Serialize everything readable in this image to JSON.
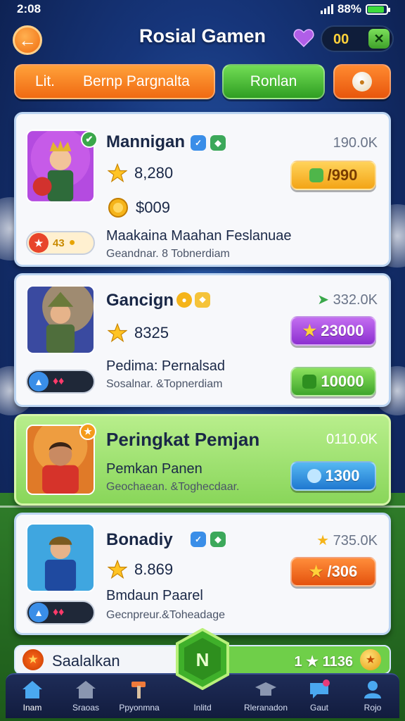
{
  "status": {
    "time": "2:08",
    "battery": "88%",
    "battery_level": 0.88
  },
  "header": {
    "title": "Rosial Gamen",
    "back_icon": "arrow-left-icon",
    "coins": "00",
    "add_label": "✕"
  },
  "tabs": [
    {
      "label_a": "Lit.",
      "label_b": "Bernp Pargnalta"
    },
    {
      "label": "Ronlan"
    },
    {
      "icon": "ball-icon"
    }
  ],
  "cards": [
    {
      "name": "Mannigan",
      "score": "190.0K",
      "stat1": "8,280",
      "stat2": "$009",
      "desc": "Maakaina Maahan Feslanuae",
      "sub": "Geandnar. 8 Tobnerdiam",
      "price": "/990",
      "rank": "43"
    },
    {
      "name": "Gancign",
      "score": "332.0K",
      "stat1": "8325",
      "desc": "Pedima: Pernalsad",
      "sub": "Sosalnar. &Topnerdiam",
      "price1": "23000",
      "price2": "10000"
    },
    {
      "name": "Peringkat Pemjan",
      "score": "0110.0K",
      "desc": "Pemkan Panen",
      "sub": "Geochaean. &Toghecdaar.",
      "price": "1300"
    },
    {
      "name": "Bonadiy",
      "score": "735.0K",
      "stat1": "8.869",
      "desc": "Bmdaun Paarel",
      "sub": "Gecnpreur.&Toheadage",
      "price": "/306"
    }
  ],
  "banner": {
    "label": "Saalalkan",
    "value": "1 ★ 1136"
  },
  "nav": [
    {
      "label": "Inam",
      "icon": "home-icon"
    },
    {
      "label": "Sraoas",
      "icon": "store-icon"
    },
    {
      "label": "Ppyonmna",
      "icon": "hammer-icon"
    },
    {
      "label": "Inlitd",
      "icon": "hex-badge-icon"
    },
    {
      "label": "Rleranadon",
      "icon": "graduation-cap-icon"
    },
    {
      "label": "Gaut",
      "icon": "chat-icon"
    },
    {
      "label": "Rojo",
      "icon": "profile-icon"
    }
  ]
}
